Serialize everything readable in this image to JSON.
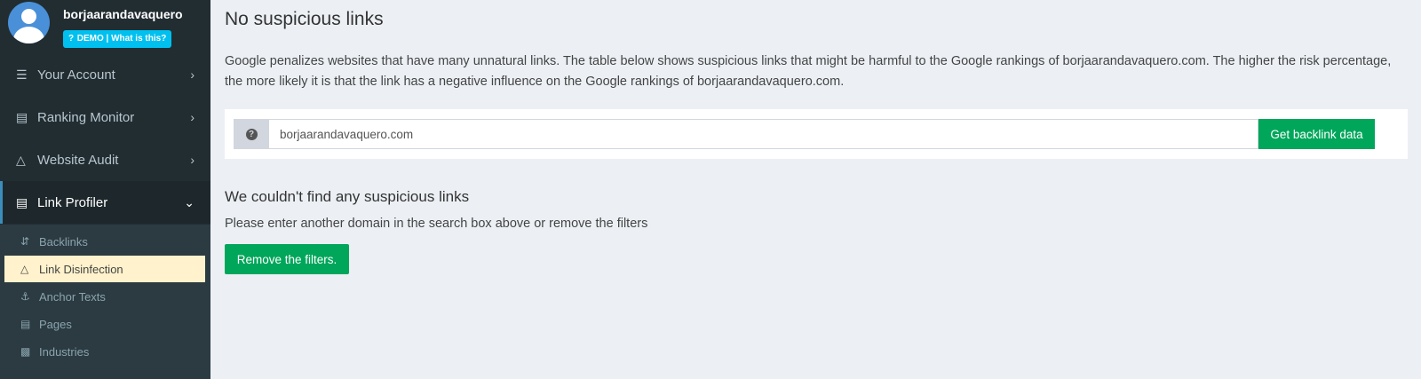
{
  "user": {
    "name": "borjaarandavaquero",
    "badge": "DEMO | What is this?"
  },
  "nav": {
    "your_account": "Your Account",
    "ranking_monitor": "Ranking Monitor",
    "website_audit": "Website Audit",
    "link_profiler": "Link Profiler"
  },
  "submenu": {
    "backlinks": "Backlinks",
    "link_disinfection": "Link Disinfection",
    "anchor_texts": "Anchor Texts",
    "pages": "Pages",
    "industries": "Industries"
  },
  "main": {
    "title": "No suspicious links",
    "intro": "Google penalizes websites that have many unnatural links. The table below shows suspicious links that might be harmful to the Google rankings of borjaarandavaquero.com. The higher the risk percentage, the more likely it is that the link has a negative influence on the Google rankings of borjaarandavaquero.com.",
    "search_value": "borjaarandavaquero.com",
    "get_button": "Get backlink data",
    "result_heading": "We couldn't find any suspicious links",
    "result_text": "Please enter another domain in the search box above or remove the filters",
    "remove_button": "Remove the filters."
  },
  "colors": {
    "sidebar": "#222d32",
    "accent_green": "#00a65a",
    "badge_blue": "#00c0ef",
    "active_sub": "#fff2cc"
  },
  "icons": [
    "user-avatar-icon",
    "list-icon",
    "bar-chart-icon",
    "flask-icon",
    "sort-icon",
    "anchor-icon",
    "file-icon",
    "building-icon",
    "question-icon",
    "chevron-right-icon",
    "chevron-down-icon"
  ]
}
